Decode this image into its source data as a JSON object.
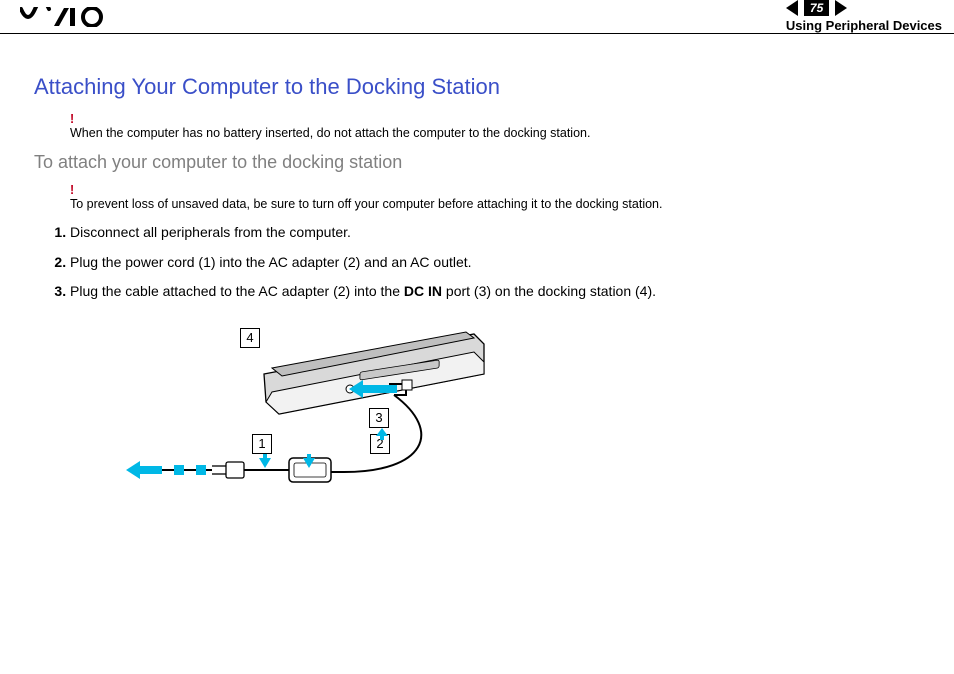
{
  "header": {
    "page_number": "75",
    "section": "Using Peripheral Devices"
  },
  "title": "Attaching Your Computer to the Docking Station",
  "warning1": "When the computer has no battery inserted, do not attach the computer to the docking station.",
  "subtitle": "To attach your computer to the docking station",
  "warning2": "To prevent loss of unsaved data, be sure to turn off your computer before attaching it to the docking station.",
  "steps": [
    "Disconnect all peripherals from the computer.",
    "Plug the power cord (1) into the AC adapter (2) and an AC outlet.",
    {
      "pre": "Plug the cable attached to the AC adapter (2) into the ",
      "bold": "DC IN",
      "post": " port (3) on the docking station (4)."
    }
  ],
  "figure": {
    "callouts": {
      "c1": "1",
      "c2": "2",
      "c3": "3",
      "c4": "4"
    }
  }
}
